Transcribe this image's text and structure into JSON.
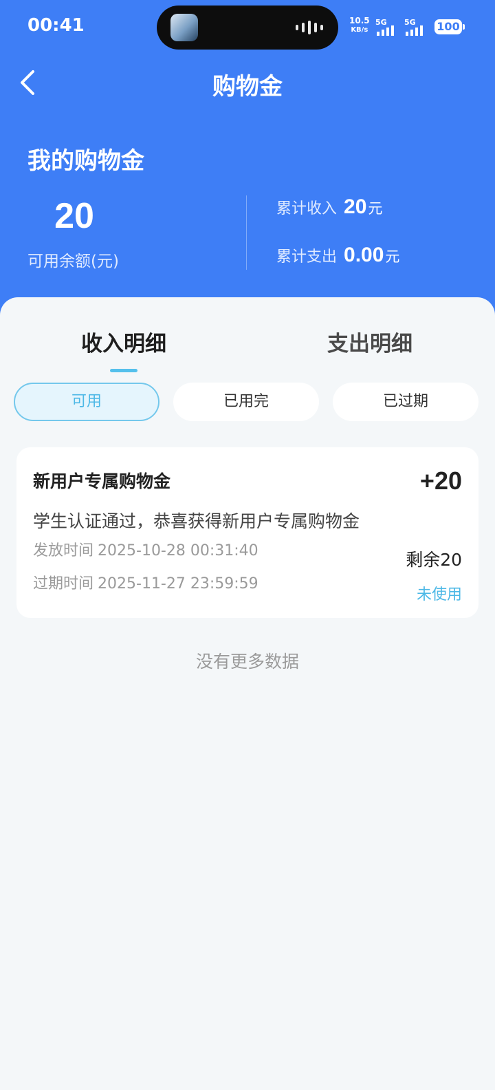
{
  "status_bar": {
    "time": "00:41",
    "net_speed_value": "10.5",
    "net_speed_unit": "KB/s",
    "sim1_label": "5G",
    "sim2_label": "5G",
    "battery": "100"
  },
  "nav": {
    "title": "购物金",
    "back_icon": "chevron-left-icon"
  },
  "summary": {
    "section_title": "我的购物金",
    "balance": "20",
    "balance_label": "可用余额(元)",
    "income_label": "累计收入",
    "income_value": "20",
    "income_unit": "元",
    "expense_label": "累计支出",
    "expense_value": "0.00",
    "expense_unit": "元"
  },
  "tabs": [
    {
      "label": "收入明细",
      "active": true
    },
    {
      "label": "支出明细",
      "active": false
    }
  ],
  "filters": [
    {
      "label": "可用",
      "active": true
    },
    {
      "label": "已用完",
      "active": false
    },
    {
      "label": "已过期",
      "active": false
    }
  ],
  "records": [
    {
      "title": "新用户专属购物金",
      "amount": "+20",
      "description": "学生认证通过，恭喜获得新用户专属购物金",
      "issue_label": "发放时间",
      "issue_time": "2025-10-28 00:31:40",
      "expire_label": "过期时间",
      "expire_time": "2025-11-27 23:59:59",
      "remaining": "剩余20",
      "status": "未使用"
    }
  ],
  "footer": {
    "no_more": "没有更多数据"
  },
  "colors": {
    "header_blue": "#3e7ef6",
    "accent_cyan": "#4cb8e6",
    "page_bg": "#f4f7f9"
  }
}
